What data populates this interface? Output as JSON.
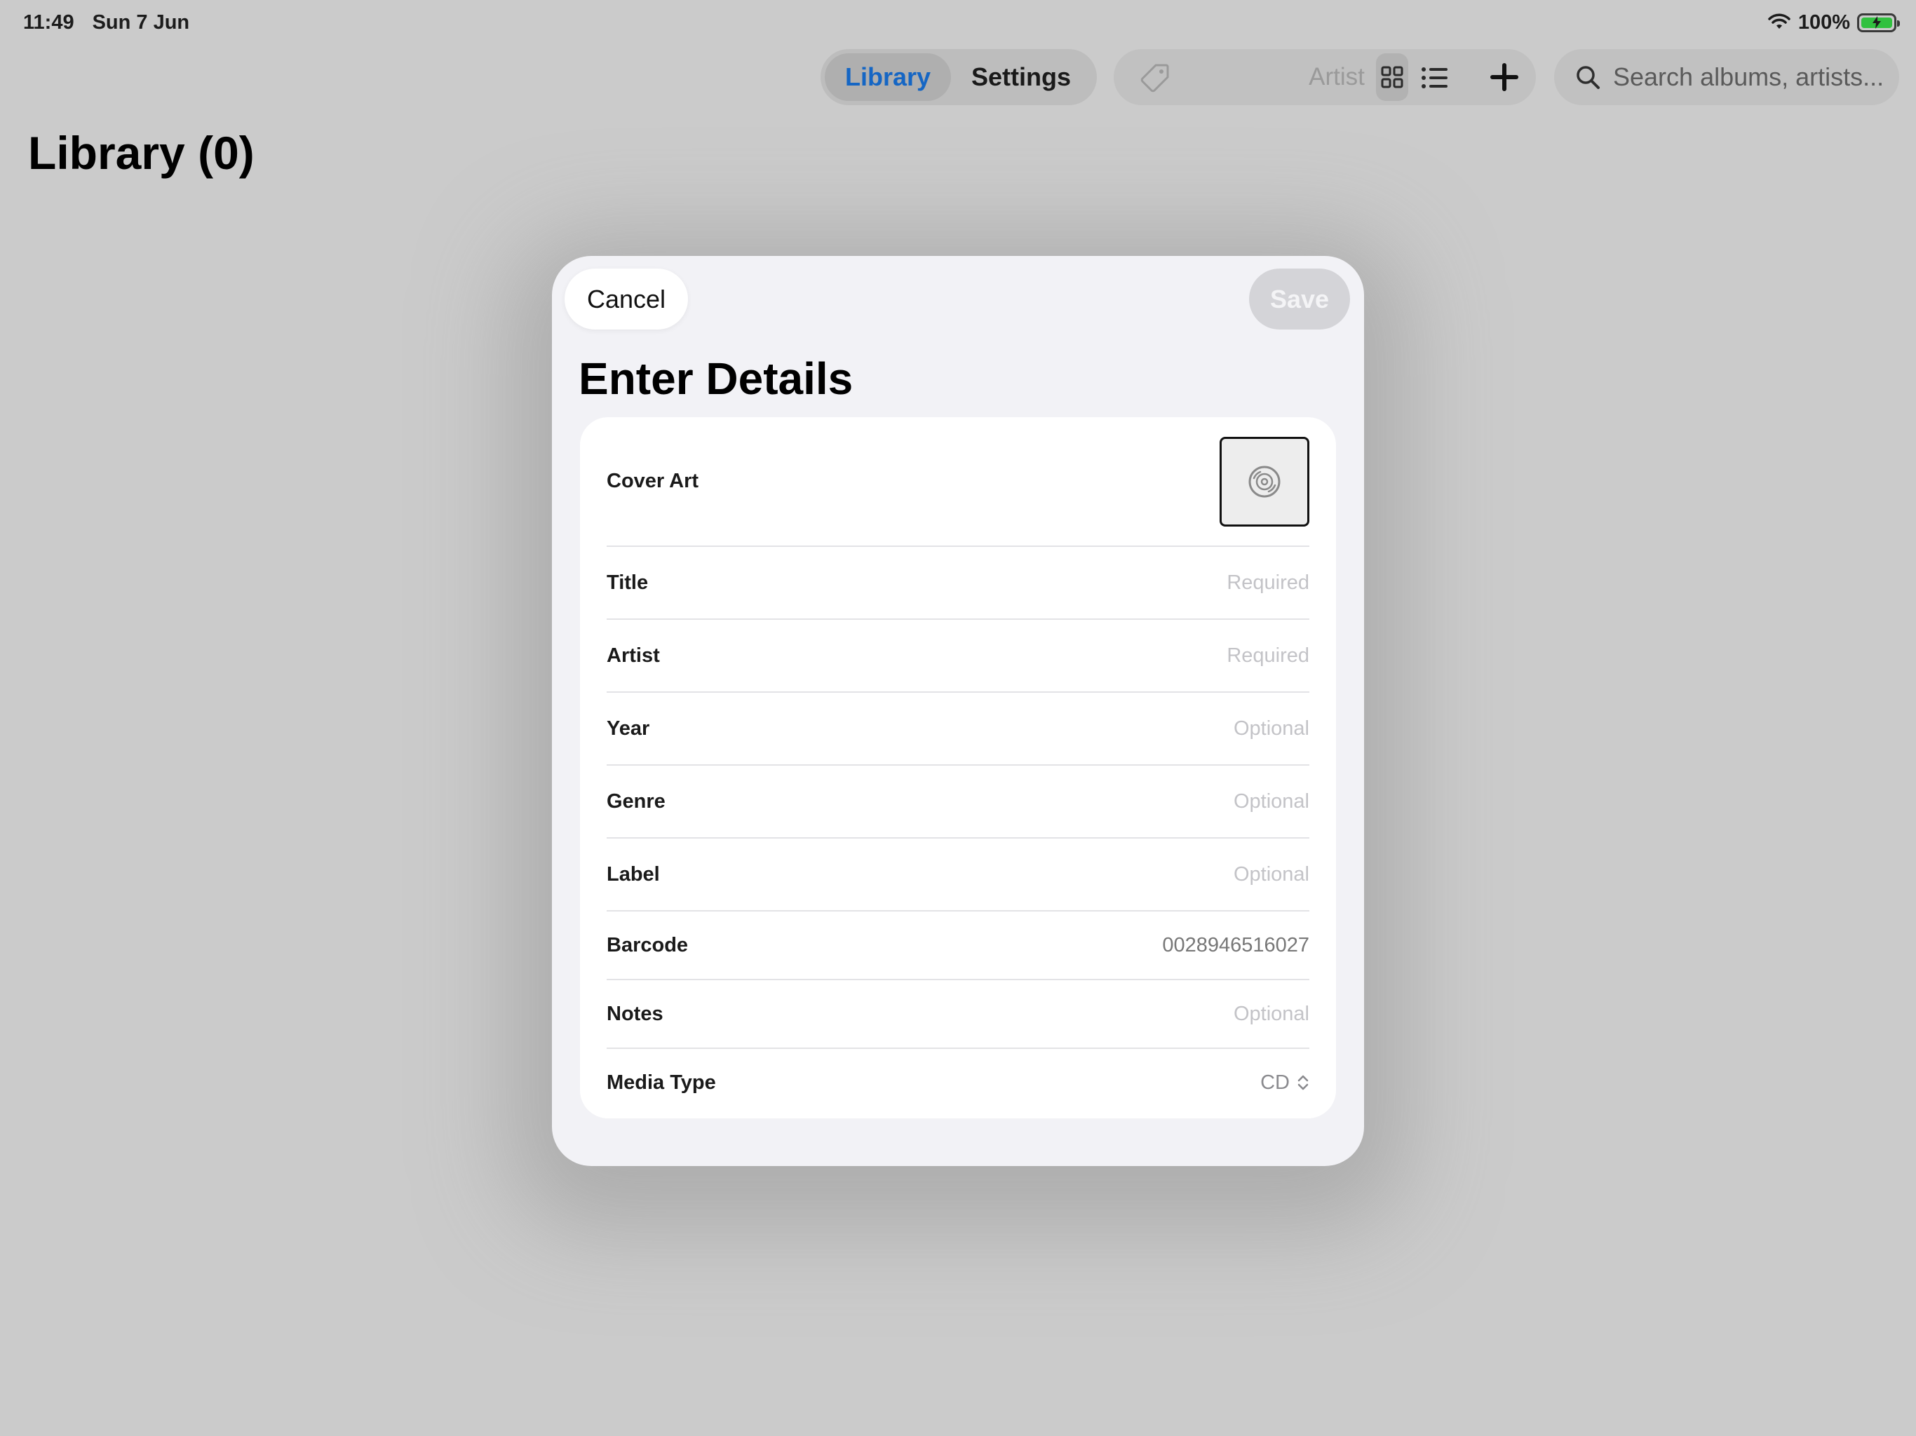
{
  "status_bar": {
    "time": "11:49",
    "date": "Sun 7 Jun",
    "battery_percent": "100%"
  },
  "toolbar": {
    "segments": [
      {
        "label": "Library",
        "active": true
      },
      {
        "label": "Settings",
        "active": false
      }
    ],
    "sort_field": "Artist",
    "search": {
      "placeholder": "Search albums, artists..."
    }
  },
  "page": {
    "title": "Library (0)"
  },
  "modal": {
    "cancel_label": "Cancel",
    "save_label": "Save",
    "title": "Enter Details",
    "cover_art_label": "Cover Art",
    "fields": [
      {
        "label": "Title",
        "value": "",
        "placeholder": "Required"
      },
      {
        "label": "Artist",
        "value": "",
        "placeholder": "Required"
      },
      {
        "label": "Year",
        "value": "",
        "placeholder": "Optional"
      },
      {
        "label": "Genre",
        "value": "",
        "placeholder": "Optional"
      },
      {
        "label": "Label",
        "value": "",
        "placeholder": "Optional"
      },
      {
        "label": "Barcode",
        "value": "0028946516027",
        "placeholder": ""
      },
      {
        "label": "Notes",
        "value": "",
        "placeholder": "Optional"
      }
    ],
    "media_type": {
      "label": "Media Type",
      "value": "CD"
    }
  },
  "colors": {
    "accent": "#1566c4",
    "battery": "#31c13f",
    "backdrop": "#cbcbcb",
    "sheet": "#f2f2f6"
  },
  "icons": [
    "wifi-icon",
    "battery-icon",
    "tag-icon",
    "grid-view-icon",
    "list-view-icon",
    "plus-icon",
    "search-icon",
    "disc-icon",
    "chevron-up-down-icon"
  ]
}
